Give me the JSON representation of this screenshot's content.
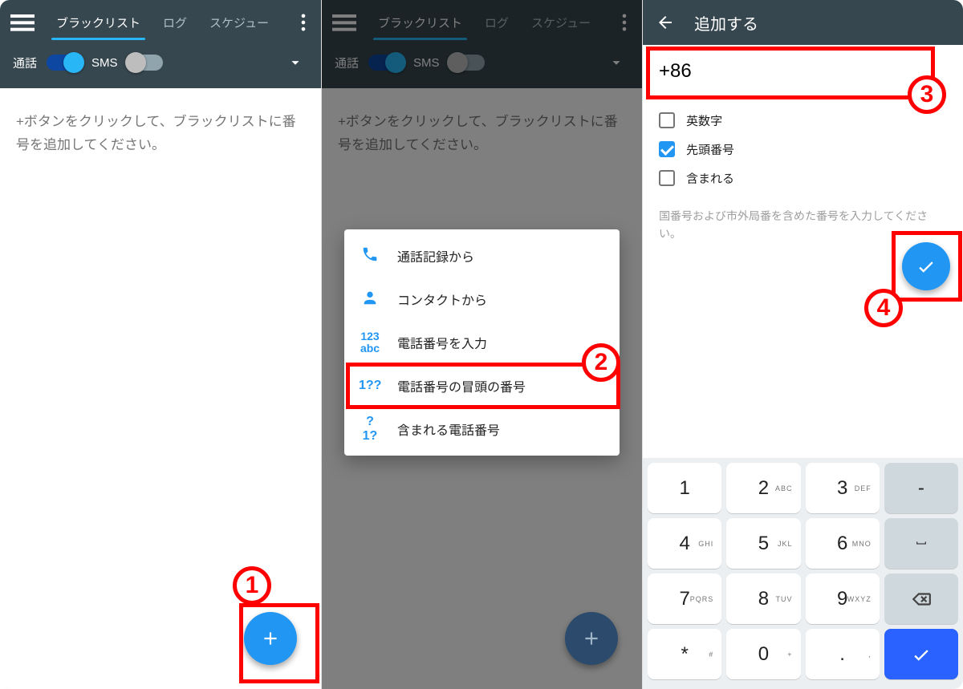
{
  "screen1": {
    "tabs": {
      "blacklist": "ブラックリスト",
      "log": "ログ",
      "schedule": "スケジュー"
    },
    "toggles": {
      "call": "通話",
      "sms": "SMS"
    },
    "empty": "+ボタンをクリックして、ブラックリストに番号を追加してください。"
  },
  "screen2": {
    "tabs": {
      "blacklist": "ブラックリスト",
      "log": "ログ",
      "schedule": "スケジュー"
    },
    "toggles": {
      "call": "通話",
      "sms": "SMS"
    },
    "empty": "+ボタンをクリックして、ブラックリストに番号を追加してください。",
    "popup": {
      "from_call_log": "通話記録から",
      "from_contacts": "コンタクトから",
      "enter_number": "電話番号を入力",
      "prefix_number": "電話番号の冒頭の番号",
      "contains_number": "含まれる電話番号",
      "icon_enter": "123\nabc",
      "icon_prefix": "1??",
      "icon_contains": "?1?"
    }
  },
  "screen3": {
    "title": "追加する",
    "input_value": "+86",
    "checks": {
      "alnum": "英数字",
      "prefix": "先頭番号",
      "contains": "含まれる"
    },
    "hint": "国番号および市外局番を含めた番号を入力してください。",
    "keypad": {
      "r1": [
        {
          "n": "1",
          "s": ""
        },
        {
          "n": "2",
          "s": "ABC"
        },
        {
          "n": "3",
          "s": "DEF"
        }
      ],
      "r2": [
        {
          "n": "4",
          "s": "GHI"
        },
        {
          "n": "5",
          "s": "JKL"
        },
        {
          "n": "6",
          "s": "MNO"
        }
      ],
      "r3": [
        {
          "n": "7",
          "s": "PQRS"
        },
        {
          "n": "8",
          "s": "TUV"
        },
        {
          "n": "9",
          "s": "WXYZ"
        }
      ],
      "r4": [
        {
          "n": "*",
          "s": "#"
        },
        {
          "n": "0",
          "s": "+"
        },
        {
          "n": ".",
          "s": ","
        }
      ],
      "side": {
        "minus": "-"
      }
    }
  },
  "annotations": {
    "n1": "1",
    "n2": "2",
    "n3": "3",
    "n4": "4"
  }
}
